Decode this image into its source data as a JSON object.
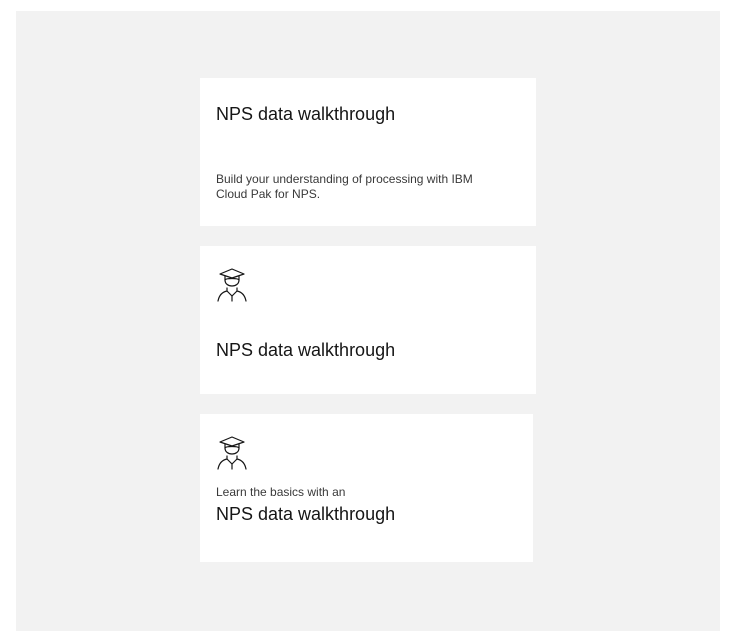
{
  "tiles": [
    {
      "title": "NPS data walkthrough",
      "description": "Build your understanding of processing with IBM Cloud Pak for NPS."
    },
    {
      "icon": "student-icon",
      "title": "NPS data walkthrough"
    },
    {
      "icon": "student-icon",
      "eyebrow": "Learn the basics with an",
      "title": "NPS data walkthrough"
    }
  ]
}
